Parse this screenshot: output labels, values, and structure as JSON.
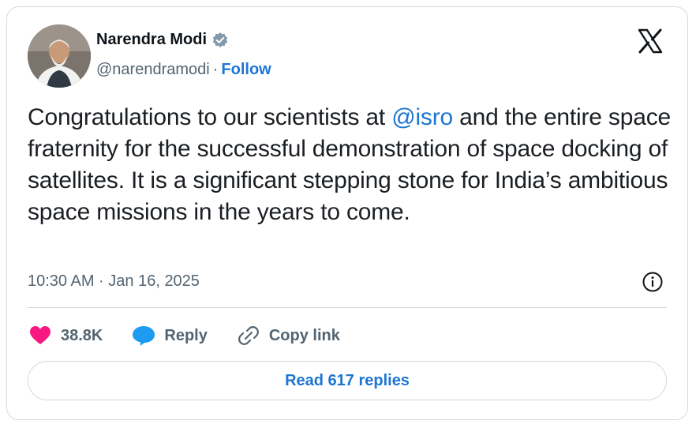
{
  "author": {
    "name": "Narendra Modi",
    "handle": "@narendramodi",
    "separator": "·",
    "follow_label": "Follow"
  },
  "tweet": {
    "text_before": "Congratulations to our scientists at ",
    "mention": "@isro",
    "text_after": " and the entire space fraternity for the successful demonstration of space docking of satellites. It is a significant stepping stone for India’s ambitious space missions in the years to come.",
    "timestamp": "10:30 AM · Jan 16, 2025"
  },
  "actions": {
    "like_count": "38.8K",
    "reply_label": "Reply",
    "copy_label": "Copy link"
  },
  "read_replies_label": "Read 617 replies",
  "colors": {
    "link": "#1d76d2",
    "like": "#f91880",
    "reply": "#1d9bf0",
    "verified": "#829aab",
    "muted": "#536471"
  }
}
